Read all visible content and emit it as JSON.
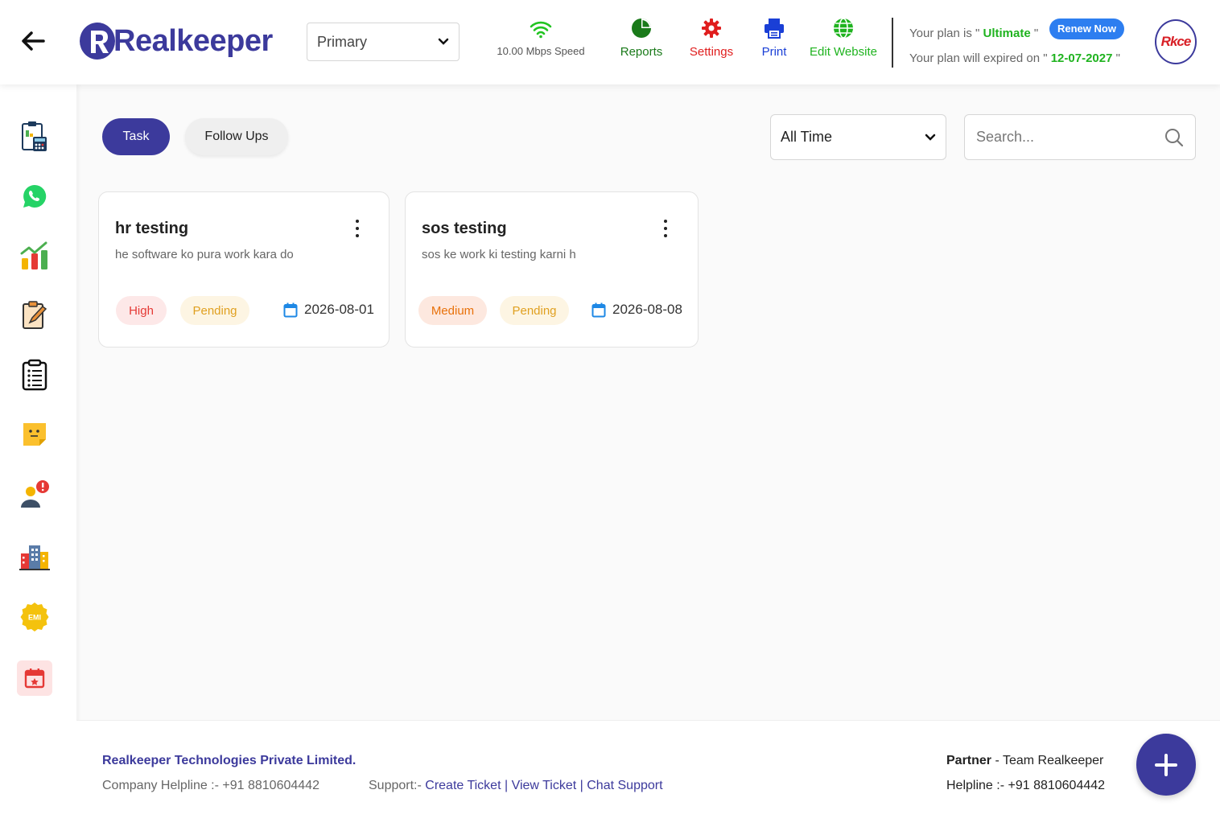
{
  "header": {
    "brand": "Realkeeper",
    "branch_select": "Primary",
    "speed": "10.00 Mbps Speed",
    "reports_label": "Reports",
    "settings_label": "Settings",
    "print_label": "Print",
    "edit_website_label": "Edit Website",
    "plan_prefix": "Your plan is \" ",
    "plan_name": "Ultimate",
    "plan_suffix": " \"",
    "renew_label": "Renew Now",
    "expiry_prefix": "Your plan will expired on \" ",
    "expiry_date": "12-07-2027",
    "expiry_suffix": " \"",
    "avatar_text": "Rkce"
  },
  "sidebar": {
    "items": [
      "calculator-icon",
      "whatsapp-icon",
      "growth-chart-icon",
      "edit-notes-icon",
      "checklist-icon",
      "sticky-note-icon",
      "user-alert-icon",
      "building-icon",
      "emi-badge-icon",
      "calendar-icon"
    ]
  },
  "tabs": {
    "task_label": "Task",
    "followups_label": "Follow Ups"
  },
  "filters": {
    "time_select": "All Time",
    "search_placeholder": "Search..."
  },
  "tasks": [
    {
      "title": "hr testing",
      "description": "he software ko pura work kara do",
      "priority": "High",
      "status": "Pending",
      "date": "2026-08-01"
    },
    {
      "title": "sos testing",
      "description": "sos ke work ki testing karni h",
      "priority": "Medium",
      "status": "Pending",
      "date": "2026-08-08"
    }
  ],
  "footer": {
    "company": "Realkeeper Technologies Private Limited.",
    "company_helpline": "Company Helpline :- +91 8810604442",
    "support_label": "Support:- ",
    "create_ticket": "Create Ticket",
    "view_ticket": "View Ticket",
    "chat_support": "Chat Support",
    "separator": " | ",
    "partner_label": "Partner",
    "partner_value": " - Team Realkeeper",
    "partner_helpline": "Helpline :- +91 8810604442"
  },
  "colors": {
    "brand": "#3c3a9c",
    "green": "#1fb31f",
    "red": "#e01e1e",
    "blue": "#1a3fd6"
  }
}
